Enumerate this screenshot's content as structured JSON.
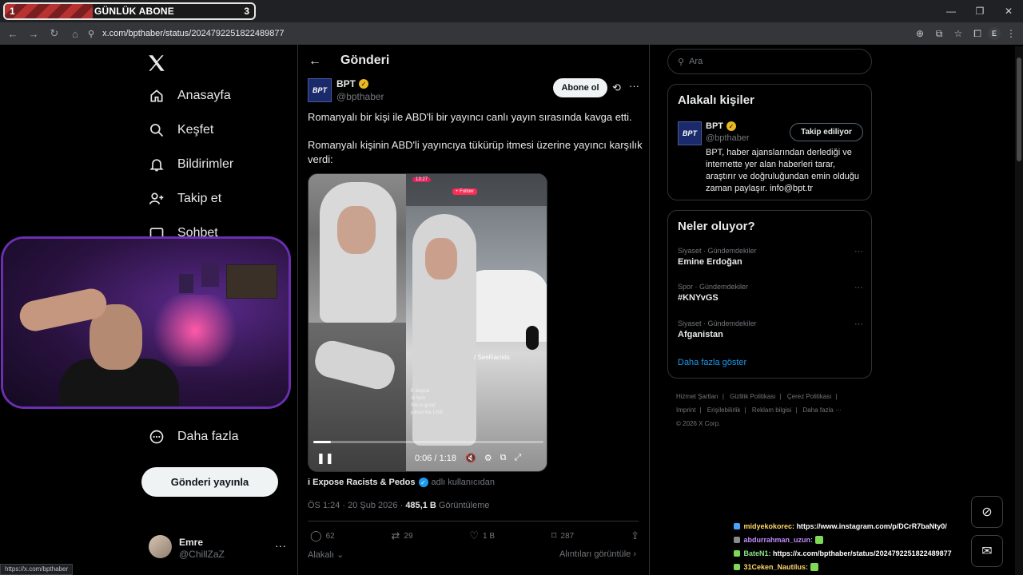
{
  "browser": {
    "tab_banner": {
      "left_number": "1",
      "title": "GÜNLÜK ABONE",
      "right_number": "3"
    },
    "url": "x.com/bpthaber/status/2024792251822489877",
    "status_url": "https://x.com/bpthaber",
    "profile_letter": "E"
  },
  "nav": {
    "items": [
      {
        "label": "Anasayfa",
        "icon": "home-icon"
      },
      {
        "label": "Keşfet",
        "icon": "search-icon"
      },
      {
        "label": "Bildirimler",
        "icon": "bell-icon"
      },
      {
        "label": "Takip et",
        "icon": "person-add-icon"
      },
      {
        "label": "Sohbet",
        "icon": "chat-icon"
      },
      {
        "label": "Daha fazla",
        "icon": "more-circle-icon"
      }
    ],
    "post_button": "Gönderi yayınla",
    "account": {
      "name": "Emre",
      "handle": "@ChillZaZ"
    }
  },
  "post": {
    "header_title": "Gönderi",
    "author": {
      "name": "BPT",
      "handle": "@bpthaber",
      "avatar_text": "BPT"
    },
    "subscribe_label": "Abone ol",
    "text_1": "Romanyalı bir kişi ile ABD'li bir yayıncı canlı yayın sırasında kavga etti.",
    "text_2": "Romanyalı kişinin ABD'li yayıncıya tükürüp itmesi üzerine yayıncı karşılık verdi:",
    "video": {
      "time": "0:06 / 1:18",
      "progress": 0.077,
      "watermark": "/ SeeRacists",
      "live_tag": "13:27",
      "follow_tag": "+ Follow",
      "comments": [
        "E dogcat",
        "Al tech",
        "this is good",
        "joined the LIVE"
      ]
    },
    "attribution_name": "i Expose Racists & Pedos",
    "attribution_suffix": "adlı kullanıcıdan",
    "meta_time": "ÖS 1:24 · 20 Şub 2026 ·",
    "meta_views": "485,1 B",
    "meta_views_label": "Görüntüleme",
    "actions": {
      "replies": "62",
      "reposts": "29",
      "likes": "1 B",
      "bookmarks": "287"
    },
    "related_left": "Alakalı",
    "related_right": "Alıntıları görüntüle"
  },
  "sidebar": {
    "search_placeholder": "Ara",
    "related_title": "Alakalı kişiler",
    "related_person": {
      "name": "BPT",
      "handle": "@bpthaber",
      "follow_label": "Takip ediliyor",
      "bio": "BPT, haber ajanslarından derlediği ve internette yer alan haberleri tarar, araştırır ve doğruluğundan emin olduğu zaman paylaşır. info@bpt.tr"
    },
    "trends_title": "Neler oluyor?",
    "trends": [
      {
        "category": "Siyaset · Gündemdekiler",
        "title": "Emine Erdoğan"
      },
      {
        "category": "Spor · Gündemdekiler",
        "title": "#KNYvGS"
      },
      {
        "category": "Siyaset · Gündemdekiler",
        "title": "Afganistan"
      }
    ],
    "show_more": "Daha fazla göster",
    "footer": [
      "Hizmet Şartları",
      "Gizlilik Politikası",
      "Çerez Politikası",
      "Imprint",
      "Erişilebilirlik",
      "Reklam bilgisi",
      "Daha fazla ···",
      "© 2026 X Corp."
    ]
  },
  "chat": [
    {
      "user": "midyekokorec:",
      "message": "https://www.instagram.com/p/DCrR7baNty0/"
    },
    {
      "user": "abdurrahman_uzun:",
      "message": ""
    },
    {
      "user": "BateN1:",
      "message": "https://x.com/bpthaber/status/2024792251822489877"
    },
    {
      "user": "31Ceken_Nautilus:",
      "message": ""
    }
  ]
}
